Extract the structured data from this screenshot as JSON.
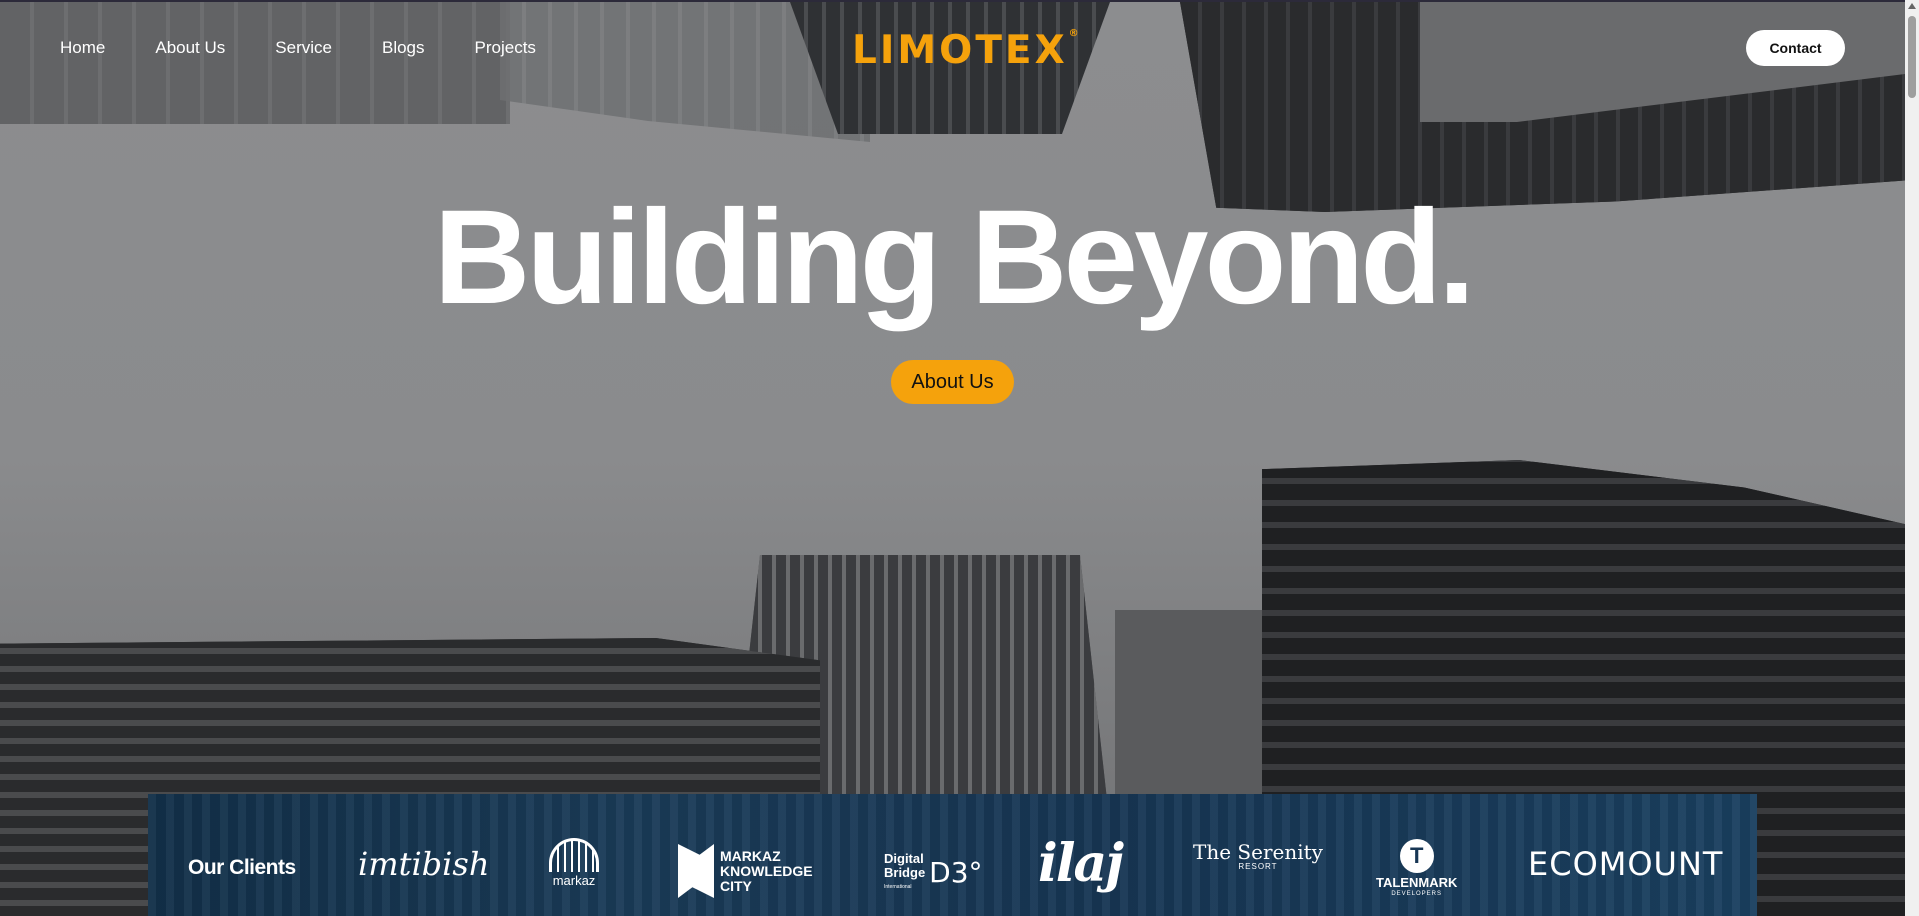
{
  "nav": {
    "items": [
      {
        "label": "Home"
      },
      {
        "label": "About Us"
      },
      {
        "label": "Service"
      },
      {
        "label": "Blogs"
      },
      {
        "label": "Projects"
      }
    ],
    "logo": "LIMOTEX",
    "logo_mark": "®",
    "contact_label": "Contact"
  },
  "hero": {
    "headline": "Building Beyond.",
    "cta_label": "About Us"
  },
  "clients": {
    "title": "Our Clients",
    "logos": {
      "imtibish": "imtibish",
      "markaz": "markaz",
      "markaz_knowledge_city": [
        "MARKAZ",
        "KNOWLEDGE",
        "CITY"
      ],
      "digital_bridge": [
        "Digital",
        "Bridge"
      ],
      "digital_bridge_sub": "International",
      "digital_bridge_mark": "D3°",
      "ilaj": "ilaj",
      "serenity": "The Serenity",
      "serenity_sub": "RESORT",
      "talenmark": "TALENMARK",
      "talenmark_sub": "DEVELOPERS",
      "talenmark_mark": "T",
      "ecomount": "ECOMOUNT"
    }
  },
  "colors": {
    "accent": "#f5a20c",
    "nav_text": "#ffffff",
    "clients_bg": "#173654"
  }
}
